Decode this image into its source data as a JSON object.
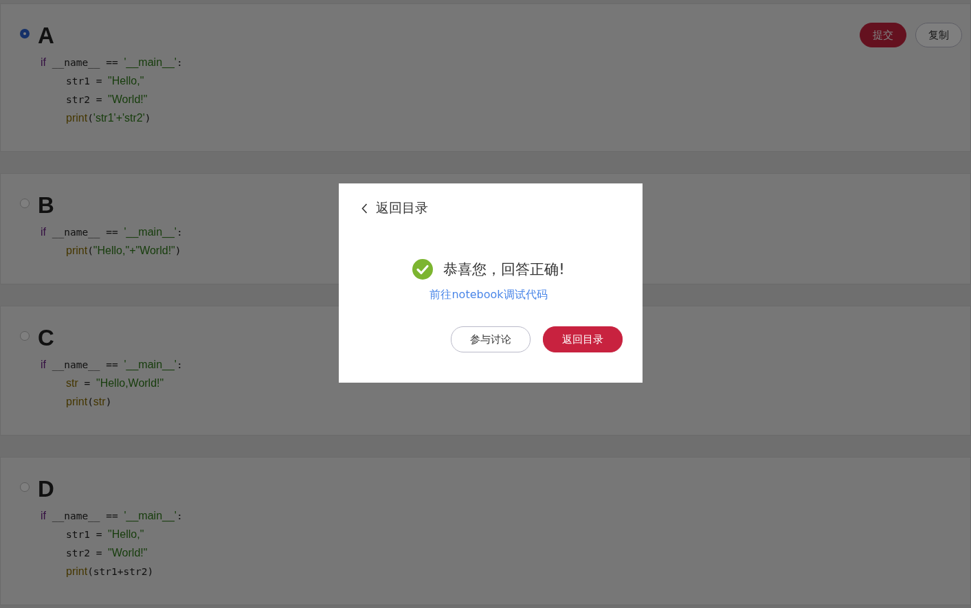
{
  "actions": [
    {
      "kind": "primary",
      "label": "提交"
    },
    {
      "kind": "outline",
      "label": "复制"
    }
  ],
  "options": [
    {
      "letter": "A",
      "selected": true,
      "lines": [
        {
          "indent": false,
          "tokens": [
            {
              "kind": "kw",
              "text": "if"
            },
            {
              "kind": "plain",
              "text": " __name__ == "
            },
            {
              "kind": "str",
              "text": "'__main__'"
            },
            {
              "kind": "plain",
              "text": ":"
            }
          ]
        },
        {
          "indent": true,
          "tokens": [
            {
              "kind": "plain",
              "text": "str1 = "
            },
            {
              "kind": "str",
              "text": "\"Hello,\""
            }
          ]
        },
        {
          "indent": true,
          "tokens": [
            {
              "kind": "plain",
              "text": "str2 = "
            },
            {
              "kind": "str",
              "text": "\"World!\""
            }
          ]
        },
        {
          "indent": true,
          "tokens": [
            {
              "kind": "fn",
              "text": "print"
            },
            {
              "kind": "plain",
              "text": "("
            },
            {
              "kind": "str",
              "text": "'str1'+'str2'"
            },
            {
              "kind": "plain",
              "text": ")"
            }
          ]
        }
      ]
    },
    {
      "letter": "B",
      "selected": false,
      "lines": [
        {
          "indent": false,
          "tokens": [
            {
              "kind": "kw",
              "text": "if"
            },
            {
              "kind": "plain",
              "text": " __name__ == "
            },
            {
              "kind": "str",
              "text": "'__main__'"
            },
            {
              "kind": "plain",
              "text": ":"
            }
          ]
        },
        {
          "indent": true,
          "tokens": [
            {
              "kind": "fn",
              "text": "print"
            },
            {
              "kind": "plain",
              "text": "("
            },
            {
              "kind": "str",
              "text": "\"Hello,\"+\"World!\""
            },
            {
              "kind": "plain",
              "text": ")"
            }
          ]
        }
      ]
    },
    {
      "letter": "C",
      "selected": false,
      "lines": [
        {
          "indent": false,
          "tokens": [
            {
              "kind": "kw",
              "text": "if"
            },
            {
              "kind": "plain",
              "text": " __name__ == "
            },
            {
              "kind": "str",
              "text": "'__main__'"
            },
            {
              "kind": "plain",
              "text": ":"
            }
          ]
        },
        {
          "indent": true,
          "tokens": [
            {
              "kind": "fn",
              "text": "str"
            },
            {
              "kind": "plain",
              "text": " = "
            },
            {
              "kind": "str",
              "text": "\"Hello,World!\""
            }
          ]
        },
        {
          "indent": true,
          "tokens": [
            {
              "kind": "fn",
              "text": "print"
            },
            {
              "kind": "plain",
              "text": "("
            },
            {
              "kind": "fn",
              "text": "str"
            },
            {
              "kind": "plain",
              "text": ")"
            }
          ]
        }
      ]
    },
    {
      "letter": "D",
      "selected": false,
      "lines": [
        {
          "indent": false,
          "tokens": [
            {
              "kind": "kw",
              "text": "if"
            },
            {
              "kind": "plain",
              "text": " __name__ == "
            },
            {
              "kind": "str",
              "text": "'__main__'"
            },
            {
              "kind": "plain",
              "text": ":"
            }
          ]
        },
        {
          "indent": true,
          "tokens": [
            {
              "kind": "plain",
              "text": "str1 = "
            },
            {
              "kind": "str",
              "text": "\"Hello,\""
            }
          ]
        },
        {
          "indent": true,
          "tokens": [
            {
              "kind": "plain",
              "text": "str2 = "
            },
            {
              "kind": "str",
              "text": "\"World!\""
            }
          ]
        },
        {
          "indent": true,
          "tokens": [
            {
              "kind": "fn",
              "text": "print"
            },
            {
              "kind": "plain",
              "text": "(str1+str2)"
            }
          ]
        }
      ]
    }
  ],
  "dialog": {
    "back_label": "返回目录",
    "message": "恭喜您，回答正确!",
    "link": "前往notebook调试代码",
    "buttons": [
      {
        "kind": "outline",
        "label": "参与讨论"
      },
      {
        "kind": "primary",
        "label": "返回目录"
      }
    ]
  }
}
